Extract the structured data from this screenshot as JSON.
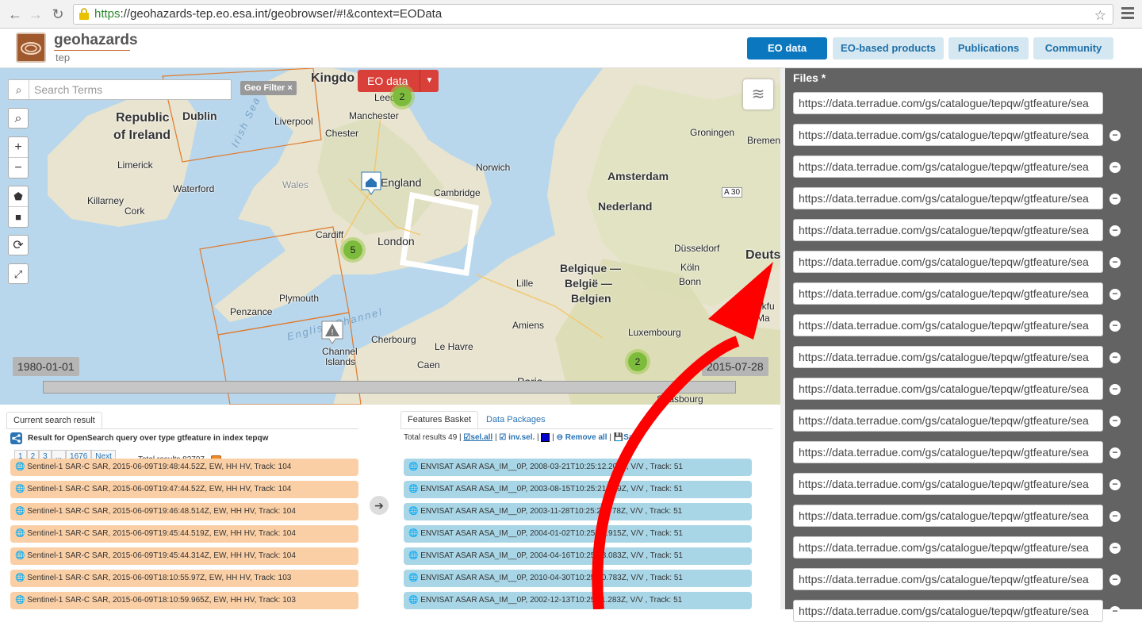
{
  "browser": {
    "url_protocol": "https",
    "url_rest": "://geohazards-tep.eo.esa.int/geobrowser/#!&context=EOData"
  },
  "header": {
    "logo_title": "geohazards",
    "logo_sub": "tep",
    "tabs": [
      {
        "label": "EO data",
        "active": true
      },
      {
        "label": "EO-based products",
        "active": false
      },
      {
        "label": "Publications",
        "active": false
      },
      {
        "label": "Community",
        "active": false
      }
    ]
  },
  "map": {
    "search_placeholder": "Search Terms",
    "geo_filter": "Geo Filter ×",
    "dataset_dropdown": "EO data",
    "labels": {
      "kingdom": "Kingdo",
      "leeds": "Leeds",
      "republic": "Republic",
      "of_ireland": "of Ireland",
      "dublin": "Dublin",
      "liverpool": "Liverpool",
      "manchester": "Manchester",
      "chester": "Chester",
      "limerick": "Limerick",
      "waterford": "Waterford",
      "killarney": "Killarney",
      "cork": "Cork",
      "wales": "Wales",
      "england": "England",
      "norwich": "Norwich",
      "cambridge": "Cambridge",
      "cardiff": "Cardiff",
      "london": "London",
      "plymouth": "Plymouth",
      "penzance": "Penzance",
      "channel_islands_1": "Channel",
      "channel_islands_2": "Islands",
      "cherbourg": "Cherbourg",
      "le_havre": "Le Havre",
      "caen": "Caen",
      "paris": "Paris",
      "amiens": "Amiens",
      "lille": "Lille",
      "belgique_1": "Belgique —",
      "belgique_2": "België —",
      "belgique_3": "Belgien",
      "luxembourg": "Luxembourg",
      "strasbourg": "Strasbourg",
      "amsterdam": "Amsterdam",
      "nederland": "Nederland",
      "groningen": "Groningen",
      "bremen": "Bremen",
      "dusseldorf": "Düsseldorf",
      "koln": "Köln",
      "bonn": "Bonn",
      "deuts": "Deuts",
      "frankfurt_1": "Frankfu",
      "frankfurt_2": "am Ma",
      "a30": "A 30",
      "irish_sea": "Irish Sea",
      "english_channel": "English Channel"
    },
    "clusters": [
      "2",
      "5",
      "2"
    ],
    "date_start": "1980-01-01",
    "date_end": "2015-07-28"
  },
  "results": {
    "tab_current": "Current search result",
    "query_text": "Result for OpenSearch query over type gtfeature in index tepqw",
    "pager": [
      "1",
      "2",
      "3",
      "...",
      "1676",
      "Next"
    ],
    "total_label": "Total results",
    "total_value": "83797",
    "rows": [
      "Sentinel-1 SAR-C SAR, 2015-06-09T19:48:44.52Z, EW, HH HV, Track: 104",
      "Sentinel-1 SAR-C SAR, 2015-06-09T19:47:44.52Z, EW, HH HV, Track: 104",
      "Sentinel-1 SAR-C SAR, 2015-06-09T19:46:48.514Z, EW, HH HV, Track: 104",
      "Sentinel-1 SAR-C SAR, 2015-06-09T19:45:44.519Z, EW, HH HV, Track: 104",
      "Sentinel-1 SAR-C SAR, 2015-06-09T19:45:44.314Z, EW, HH HV, Track: 104",
      "Sentinel-1 SAR-C SAR, 2015-06-09T18:10:55.97Z, EW, HH HV, Track: 103",
      "Sentinel-1 SAR-C SAR, 2015-06-09T18:10:59.965Z, EW, HH HV, Track: 103"
    ]
  },
  "basket": {
    "tab_features": "Features Basket",
    "tab_packages": "Data Packages",
    "total_label": "Total results",
    "total_value": "49",
    "sel_all": "sel.all",
    "inv_sel": "inv.sel.",
    "remove_all": "Remove all",
    "save": "Save",
    "rows": [
      "ENVISAT ASAR ASA_IM__0P, 2008-03-21T10:25:12.202Z, V/V , Track: 51",
      "ENVISAT ASAR ASA_IM__0P, 2003-08-15T10:25:21.519Z, V/V , Track: 51",
      "ENVISAT ASAR ASA_IM__0P, 2003-11-28T10:25:20.778Z, V/V , Track: 51",
      "ENVISAT ASAR ASA_IM__0P, 2004-01-02T10:25:21.915Z, V/V , Track: 51",
      "ENVISAT ASAR ASA_IM__0P, 2004-04-16T10:25:18.083Z, V/V , Track: 51",
      "ENVISAT ASAR ASA_IM__0P, 2010-04-30T10:25:00.783Z, V/V , Track: 51",
      "ENVISAT ASAR ASA_IM__0P, 2002-12-13T10:25:11.283Z, V/V , Track: 51"
    ]
  },
  "files": {
    "label": "Files *",
    "values": [
      "https://data.terradue.com/gs/catalogue/tepqw/gtfeature/sea",
      "https://data.terradue.com/gs/catalogue/tepqw/gtfeature/sea",
      "https://data.terradue.com/gs/catalogue/tepqw/gtfeature/sea",
      "https://data.terradue.com/gs/catalogue/tepqw/gtfeature/sea",
      "https://data.terradue.com/gs/catalogue/tepqw/gtfeature/sea",
      "https://data.terradue.com/gs/catalogue/tepqw/gtfeature/sea",
      "https://data.terradue.com/gs/catalogue/tepqw/gtfeature/sea",
      "https://data.terradue.com/gs/catalogue/tepqw/gtfeature/sea",
      "https://data.terradue.com/gs/catalogue/tepqw/gtfeature/sea",
      "https://data.terradue.com/gs/catalogue/tepqw/gtfeature/sea",
      "https://data.terradue.com/gs/catalogue/tepqw/gtfeature/sea",
      "https://data.terradue.com/gs/catalogue/tepqw/gtfeature/sea",
      "https://data.terradue.com/gs/catalogue/tepqw/gtfeature/sea",
      "https://data.terradue.com/gs/catalogue/tepqw/gtfeature/sea",
      "https://data.terradue.com/gs/catalogue/tepqw/gtfeature/sea",
      "https://data.terradue.com/gs/catalogue/tepqw/gtfeature/sea",
      "https://data.terradue.com/gs/catalogue/tepqw/gtfeature/sea"
    ]
  },
  "colors": {
    "accent": "#0b77be",
    "dropdown_red": "#d9403a",
    "result_orange": "#fbcfa5",
    "basket_blue": "#a9d6e6",
    "annotation_arrow": "#ff0000"
  }
}
